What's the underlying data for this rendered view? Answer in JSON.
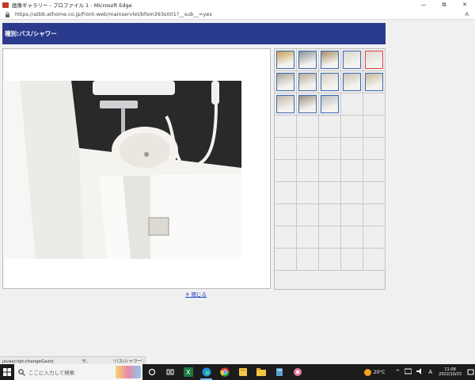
{
  "window": {
    "title": "画像ギャラリー - プロファイル 1 - Microsoft Edge",
    "minimize": "—",
    "restore": "⧉",
    "close": "✕"
  },
  "address": {
    "url": "https://atbb.athome.co.jp/front-web/mainservlet/bfom393s001?__sub__=yes",
    "reader_icon": "A"
  },
  "page": {
    "heading": "種別:バス/シャワー",
    "close_link": "✕ 閉じる"
  },
  "thumbnails": [
    {
      "name": "thumb-1",
      "tone": "#c9a050",
      "active": false
    },
    {
      "name": "thumb-2",
      "tone": "#8a8f96",
      "active": false
    },
    {
      "name": "thumb-3",
      "tone": "#a98a62",
      "active": false
    },
    {
      "name": "thumb-4",
      "tone": "#d9d6cf",
      "active": false
    },
    {
      "name": "thumb-5",
      "tone": "#dcd8d0",
      "active": true
    },
    {
      "name": "thumb-6",
      "tone": "#a9a497",
      "active": false
    },
    {
      "name": "thumb-7",
      "tone": "#b8aa92",
      "active": false
    },
    {
      "name": "thumb-8",
      "tone": "#d6cfbf",
      "active": false
    },
    {
      "name": "thumb-9",
      "tone": "#c8c2b6",
      "active": false
    },
    {
      "name": "thumb-10",
      "tone": "#c6b89c",
      "active": false
    },
    {
      "name": "thumb-11",
      "tone": "#bfb6a6",
      "active": false
    },
    {
      "name": "thumb-12",
      "tone": "#9a8e7e",
      "active": false
    },
    {
      "name": "thumb-13",
      "tone": "#b7bcc2",
      "active": false
    }
  ],
  "grid": {
    "columns": 5,
    "rows": 10
  },
  "status": {
    "text": "javascript:changeGazo(                    '5',                  'バス/シャワー', ..."
  },
  "taskbar": {
    "search_placeholder": "ここに入力して検索",
    "temperature": "20°C",
    "tray_chevron": "^",
    "ime": "A",
    "time": "11:08",
    "date": "2022/10/23"
  },
  "colors": {
    "header": "#2a3a8c",
    "taskbar": "#1c1c1c",
    "link": "#1a3fc4"
  }
}
